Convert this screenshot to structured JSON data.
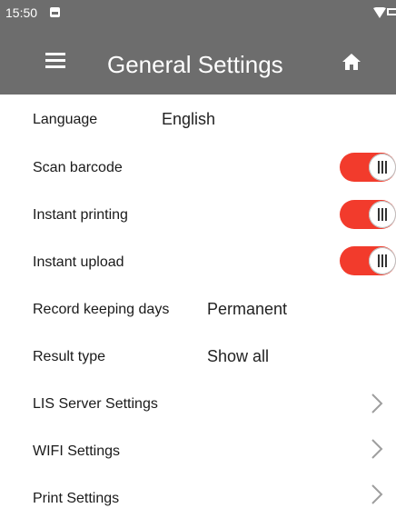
{
  "status_bar": {
    "time": "15:50",
    "icons": [
      "notification-icon",
      "wifi-icon",
      "battery-icon"
    ]
  },
  "app_bar": {
    "title": "General Settings",
    "menu_icon": "menu-icon",
    "home_icon": "home-icon",
    "background": "#6d6d6d"
  },
  "settings": {
    "language": {
      "label": "Language",
      "value": "English"
    },
    "scan_barcode": {
      "label": "Scan barcode",
      "on": true
    },
    "instant_printing": {
      "label": "Instant printing",
      "on": true
    },
    "instant_upload": {
      "label": "Instant upload",
      "on": true
    },
    "record_keeping": {
      "label": "Record keeping days",
      "value": "Permanent"
    },
    "result_type": {
      "label": "Result type",
      "value": "Show all"
    },
    "lis_server": {
      "label": "LIS Server Settings"
    },
    "wifi": {
      "label": "WIFI Settings"
    },
    "print": {
      "label": "Print Settings"
    }
  },
  "colors": {
    "toggle_on": "#f23b2c",
    "chevron": "#9e9e9e"
  }
}
